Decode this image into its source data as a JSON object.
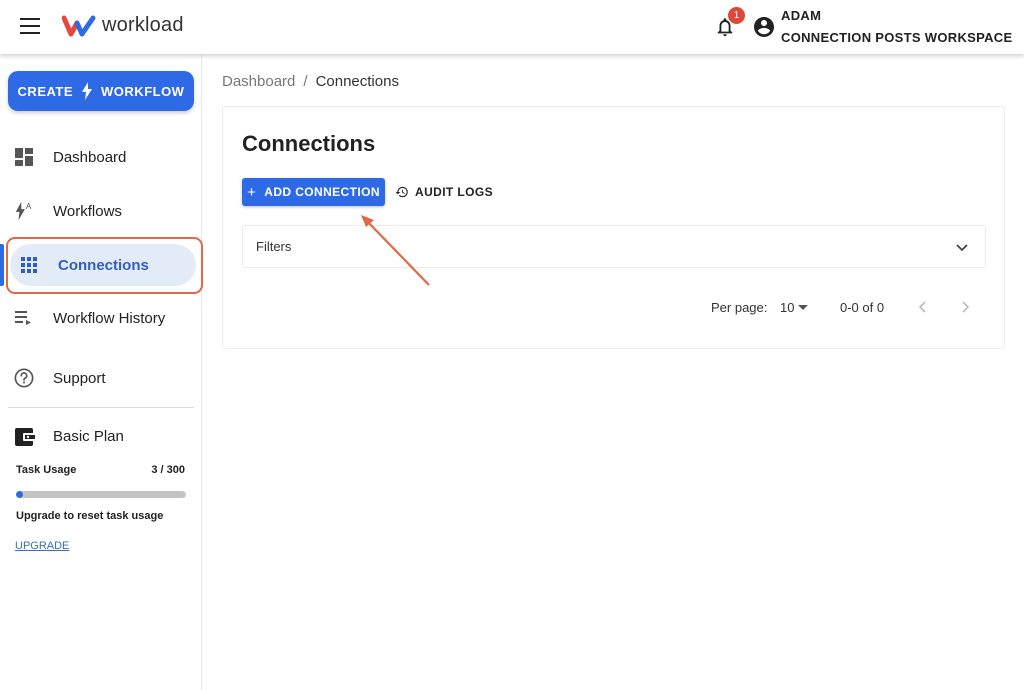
{
  "header": {
    "logo_text": "workload",
    "notification_count": "1",
    "user_name": "ADAM",
    "workspace": "CONNECTION POSTS WORKSPACE"
  },
  "sidebar": {
    "create_left": "CREATE",
    "create_right": "WORKFLOW",
    "items": [
      {
        "label": "Dashboard",
        "icon": "dashboard-icon"
      },
      {
        "label": "Workflows",
        "icon": "workflows-icon"
      },
      {
        "label": "Connections",
        "icon": "apps-grid-icon",
        "active": true
      },
      {
        "label": "Workflow History",
        "icon": "playlist-icon"
      },
      {
        "label": "Support",
        "icon": "help-circle-icon"
      }
    ],
    "plan_label": "Basic Plan",
    "task_label": "Task Usage",
    "task_count": "3 / 300",
    "task_usage_fraction": 0.01,
    "upgrade_note": "Upgrade to reset task usage",
    "upgrade_link": "UPGRADE"
  },
  "breadcrumb": {
    "root": "Dashboard",
    "separator": "/",
    "current": "Connections"
  },
  "main": {
    "title": "Connections",
    "add_button": "ADD CONNECTION",
    "audit_button": "AUDIT LOGS",
    "filters_label": "Filters",
    "per_page_label": "Per page:",
    "per_page_value": "10",
    "range_label": "0-0 of 0"
  },
  "colors": {
    "accent": "#2f6ae6",
    "highlight": "#e06848"
  }
}
